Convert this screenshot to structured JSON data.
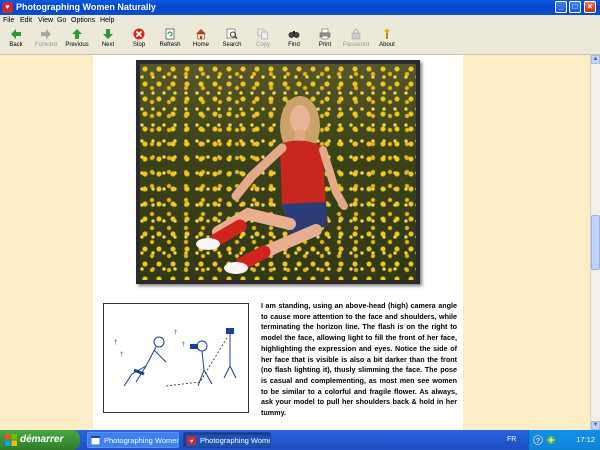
{
  "window": {
    "title": "Photographing Women Naturally",
    "app_icon": "book-icon"
  },
  "menu": [
    "File",
    "Edit",
    "View",
    "Go",
    "Options",
    "Help"
  ],
  "toolbar": [
    {
      "label": "Back",
      "icon": "back-arrow-icon",
      "enabled": true
    },
    {
      "label": "Forward",
      "icon": "forward-arrow-icon",
      "enabled": false
    },
    {
      "label": "Previous",
      "icon": "up-arrow-icon",
      "enabled": true
    },
    {
      "label": "Next",
      "icon": "down-arrow-icon",
      "enabled": true
    },
    {
      "label": "Stop",
      "icon": "stop-icon",
      "enabled": true
    },
    {
      "label": "Refresh",
      "icon": "refresh-icon",
      "enabled": true
    },
    {
      "label": "Home",
      "icon": "home-icon",
      "enabled": true
    },
    {
      "label": "Search",
      "icon": "search-icon",
      "enabled": true
    },
    {
      "label": "Copy",
      "icon": "copy-icon",
      "enabled": false
    },
    {
      "label": "Find",
      "icon": "find-icon",
      "enabled": true
    },
    {
      "label": "Print",
      "icon": "print-icon",
      "enabled": true
    },
    {
      "label": "Password",
      "icon": "password-icon",
      "enabled": false
    },
    {
      "label": "About",
      "icon": "about-icon",
      "enabled": true
    }
  ],
  "content": {
    "description": "I am standing, using an above-head (high) camera angle to cause more attention to the face and shoulders, while terminating the horizon line. The flash is on the right to model the face, allowing light to fill the front of her face, highlighting the expression and eyes. Notice the side of her face that is visible is also a bit darker than the front (no flash lighting it), thusly slimming the face. The pose is casual and complementing, as most men see women to be similar to a colorful and fragile flower. As always, ask your model to pull her shoulders back & hold in her tummy."
  },
  "taskbar": {
    "start_label": "démarrer",
    "tasks": [
      "Photographing Women...",
      "Photographing Women..."
    ],
    "language": "FR",
    "clock": "17:12"
  },
  "colors": {
    "page_background": "#fdedc6",
    "titlebar": "#0a5ae0",
    "taskbar": "#245edb",
    "start_button": "#3c9335"
  }
}
